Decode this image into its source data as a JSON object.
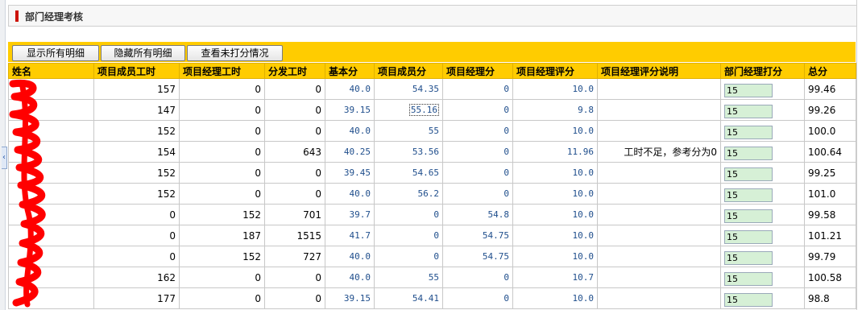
{
  "header": {
    "title": "部门经理考核"
  },
  "toolbar": {
    "show_all": "显示所有明细",
    "hide_all": "隐藏所有明细",
    "view_unscored": "查看未打分情况"
  },
  "table": {
    "columns": [
      "姓名",
      "项目成员工时",
      "项目经理工时",
      "分发工时",
      "基本分",
      "项目成员分",
      "项目经理分",
      "项目经理评分",
      "项目经理评分说明",
      "部门经理打分",
      "总分"
    ],
    "rows": [
      {
        "name": "",
        "member_hours": "157",
        "pm_hours": "0",
        "dist_hours": "0",
        "base": "40.0",
        "member_score": "54.35",
        "pm_score": "0",
        "pm_rating": "10.0",
        "remark": "",
        "dept_score": "15",
        "total": "99.46"
      },
      {
        "name": "",
        "member_hours": "147",
        "pm_hours": "0",
        "dist_hours": "0",
        "base": "39.15",
        "member_score": "55.16",
        "pm_score": "0",
        "pm_rating": "9.8",
        "remark": "",
        "dept_score": "15",
        "total": "99.26"
      },
      {
        "name": "",
        "member_hours": "152",
        "pm_hours": "0",
        "dist_hours": "0",
        "base": "40.0",
        "member_score": "55",
        "pm_score": "0",
        "pm_rating": "10.0",
        "remark": "",
        "dept_score": "15",
        "total": "100.0"
      },
      {
        "name": "",
        "member_hours": "154",
        "pm_hours": "0",
        "dist_hours": "643",
        "base": "40.25",
        "member_score": "53.56",
        "pm_score": "0",
        "pm_rating": "11.96",
        "remark": "工时不足，参考分为0",
        "dept_score": "15",
        "total": "100.64"
      },
      {
        "name": "",
        "member_hours": "152",
        "pm_hours": "0",
        "dist_hours": "0",
        "base": "39.45",
        "member_score": "54.65",
        "pm_score": "0",
        "pm_rating": "10.0",
        "remark": "",
        "dept_score": "15",
        "total": "99.25"
      },
      {
        "name": "",
        "member_hours": "152",
        "pm_hours": "0",
        "dist_hours": "0",
        "base": "40.0",
        "member_score": "56.2",
        "pm_score": "0",
        "pm_rating": "10.0",
        "remark": "",
        "dept_score": "15",
        "total": "101.0"
      },
      {
        "name": "",
        "member_hours": "0",
        "pm_hours": "152",
        "dist_hours": "701",
        "base": "39.7",
        "member_score": "0",
        "pm_score": "54.8",
        "pm_rating": "10.0",
        "remark": "",
        "dept_score": "15",
        "total": "99.58"
      },
      {
        "name": "",
        "member_hours": "0",
        "pm_hours": "187",
        "dist_hours": "1515",
        "base": "41.7",
        "member_score": "0",
        "pm_score": "54.75",
        "pm_rating": "10.0",
        "remark": "",
        "dept_score": "15",
        "total": "101.21"
      },
      {
        "name": "",
        "member_hours": "0",
        "pm_hours": "152",
        "dist_hours": "727",
        "base": "40.0",
        "member_score": "0",
        "pm_score": "54.75",
        "pm_rating": "10.0",
        "remark": "",
        "dept_score": "15",
        "total": "99.79"
      },
      {
        "name": "",
        "member_hours": "162",
        "pm_hours": "0",
        "dist_hours": "0",
        "base": "40.0",
        "member_score": "55",
        "pm_score": "0",
        "pm_rating": "10.7",
        "remark": "",
        "dept_score": "15",
        "total": "100.58"
      },
      {
        "name": "",
        "member_hours": "177",
        "pm_hours": "0",
        "dist_hours": "0",
        "base": "39.15",
        "member_score": "54.41",
        "pm_score": "0",
        "pm_rating": "10.0",
        "remark": "",
        "dept_score": "15",
        "total": "98.8"
      }
    ]
  },
  "colors": {
    "toolbar_bg": "#ffcc00",
    "accent": "#cc1100",
    "input_bg": "#d6f0d6",
    "link": "#1c3f94",
    "redaction": "#ff0000"
  },
  "icons": {
    "collapse_tab": "chevron-left-icon"
  }
}
